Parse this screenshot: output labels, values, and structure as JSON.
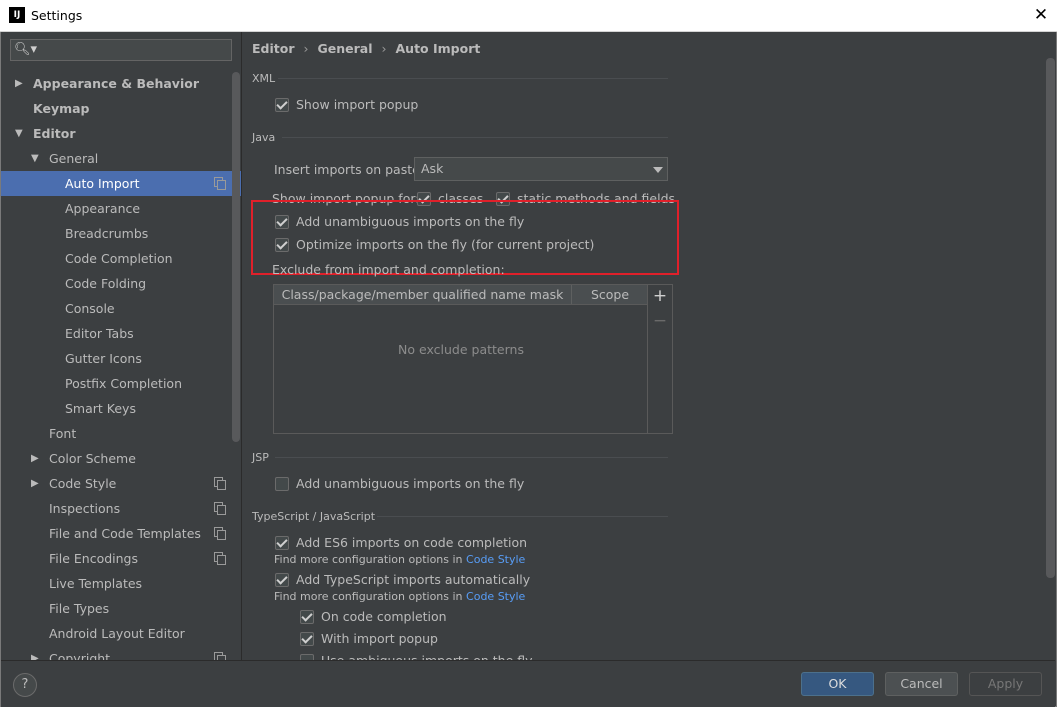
{
  "window": {
    "title": "Settings",
    "app_icon_text": "IJ"
  },
  "sidebar": {
    "search_placeholder": "",
    "items": [
      {
        "label": "Appearance & Behavior"
      },
      {
        "label": "Keymap"
      },
      {
        "label": "Editor"
      },
      {
        "label": "General"
      },
      {
        "label": "Auto Import"
      },
      {
        "label": "Appearance"
      },
      {
        "label": "Breadcrumbs"
      },
      {
        "label": "Code Completion"
      },
      {
        "label": "Code Folding"
      },
      {
        "label": "Console"
      },
      {
        "label": "Editor Tabs"
      },
      {
        "label": "Gutter Icons"
      },
      {
        "label": "Postfix Completion"
      },
      {
        "label": "Smart Keys"
      },
      {
        "label": "Font"
      },
      {
        "label": "Color Scheme"
      },
      {
        "label": "Code Style"
      },
      {
        "label": "Inspections"
      },
      {
        "label": "File and Code Templates"
      },
      {
        "label": "File Encodings"
      },
      {
        "label": "Live Templates"
      },
      {
        "label": "File Types"
      },
      {
        "label": "Android Layout Editor"
      },
      {
        "label": "Copyright"
      }
    ]
  },
  "breadcrumb": {
    "items": [
      "Editor",
      "General",
      "Auto Import"
    ]
  },
  "xml": {
    "title": "XML",
    "show_import_popup": "Show import popup"
  },
  "java": {
    "title": "Java",
    "insert_label": "Insert imports on paste:",
    "insert_value": "Ask",
    "popup_for_label": "Show import popup for:",
    "classes": "classes",
    "static_methods": "static methods and fields",
    "unambiguous": "Add unambiguous imports on the fly",
    "optimize": "Optimize imports on the fly (for current project)",
    "exclude_label": "Exclude from import and completion:",
    "col_mask": "Class/package/member qualified name mask",
    "col_scope": "Scope",
    "empty": "No exclude patterns",
    "add_symbol": "+",
    "remove_symbol": "−"
  },
  "jsp": {
    "title": "JSP",
    "unambiguous": "Add unambiguous imports on the fly"
  },
  "ts": {
    "title": "TypeScript / JavaScript",
    "es6": "Add ES6 imports on code completion",
    "hint_prefix": "Find more configuration options in",
    "hint_link": "Code Style",
    "ts_auto": "Add TypeScript imports automatically",
    "on_completion": "On code completion",
    "with_popup": "With import popup",
    "partial": "Use ambiguous imports on the fly"
  },
  "footer": {
    "help": "?",
    "ok": "OK",
    "cancel": "Cancel",
    "apply": "Apply"
  },
  "colors": {
    "background": "#3c3f41",
    "selection": "#4b6eaf",
    "highlight_box": "#e0202a",
    "link": "#589df6",
    "ok_button": "#365880"
  }
}
